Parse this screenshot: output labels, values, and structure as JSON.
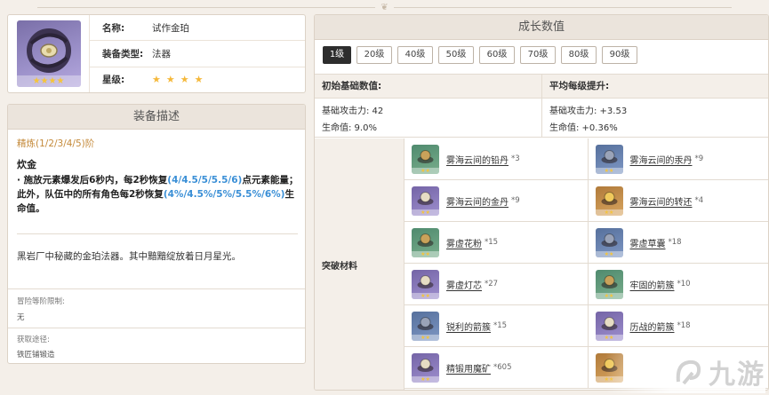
{
  "item": {
    "name_label": "名称:",
    "name": "试作金珀",
    "type_label": "装备类型:",
    "type": "法器",
    "rarity_label": "星级:",
    "rarity": 4
  },
  "description": {
    "header": "装备描述",
    "refine": "精炼(1/2/3/4/5)阶",
    "passive_name": "炊金",
    "passive_parts": [
      {
        "t": "· 施放元素爆发后6秒内，每2秒恢复",
        "hl": false
      },
      {
        "t": "(4/4.5/5/5.5/6)",
        "hl": true
      },
      {
        "t": "点元素能量；此外，队伍中的所有角色每2秒恢复",
        "hl": false
      },
      {
        "t": "(4%/4.5%/5%/5.5%/6%)",
        "hl": true
      },
      {
        "t": "生命值。",
        "hl": false
      }
    ],
    "lore": "黑岩厂中秘藏的金珀法器。其中黯黯绽放着日月星光。",
    "req_label": "冒险等阶限制:",
    "req_value": "无",
    "source_label": "获取途径:",
    "source_value": "铁匠铺锻造"
  },
  "growth": {
    "header": "成长数值",
    "levels": [
      "1级",
      "20级",
      "40级",
      "50级",
      "60级",
      "70级",
      "80级",
      "90级"
    ],
    "active_level": 0,
    "base_header": "初始基础数值:",
    "avg_header": "平均每级提升:",
    "base_atk": "基础攻击力: 42",
    "base_hp": "生命值: 9.0%",
    "avg_atk": "基础攻击力: +3.53",
    "avg_hp": "生命值: +0.36%",
    "materials_label": "突破材料",
    "materials": [
      {
        "name": "雾海云间的铅丹",
        "count": "*3",
        "quality": "green",
        "icon": "lead-pill-icon"
      },
      {
        "name": "雾海云间的汞丹",
        "count": "*9",
        "quality": "blue",
        "icon": "mercury-pill-icon"
      },
      {
        "name": "雾海云间的金丹",
        "count": "*9",
        "quality": "purple",
        "icon": "gold-pill-icon"
      },
      {
        "name": "雾海云间的转还",
        "count": "*4",
        "quality": "gold",
        "icon": "return-pill-icon"
      },
      {
        "name": "雾虚花粉",
        "count": "*15",
        "quality": "green",
        "icon": "pollen-icon"
      },
      {
        "name": "雾虚草囊",
        "count": "*18",
        "quality": "blue",
        "icon": "grass-sac-icon"
      },
      {
        "name": "雾虚灯芯",
        "count": "*27",
        "quality": "purple",
        "icon": "lamp-wick-icon"
      },
      {
        "name": "牢固的箭簇",
        "count": "*10",
        "quality": "green",
        "icon": "arrowhead-icon"
      },
      {
        "name": "锐利的箭簇",
        "count": "*15",
        "quality": "blue",
        "icon": "sharp-arrowhead-icon"
      },
      {
        "name": "历战的箭簇",
        "count": "*18",
        "quality": "purple",
        "icon": "veteran-arrowhead-icon"
      },
      {
        "name": "精锻用魔矿",
        "count": "*605",
        "quality": "purple",
        "icon": "mystic-ore-icon"
      },
      {
        "name": "",
        "count": "",
        "quality": "gold",
        "icon": "mora-icon"
      }
    ]
  },
  "watermark": {
    "text": "九游"
  },
  "colors": {
    "accent_blue": "#3a8fd6",
    "refine_gold": "#c48a3a",
    "star_yellow": "#f5b83a"
  }
}
